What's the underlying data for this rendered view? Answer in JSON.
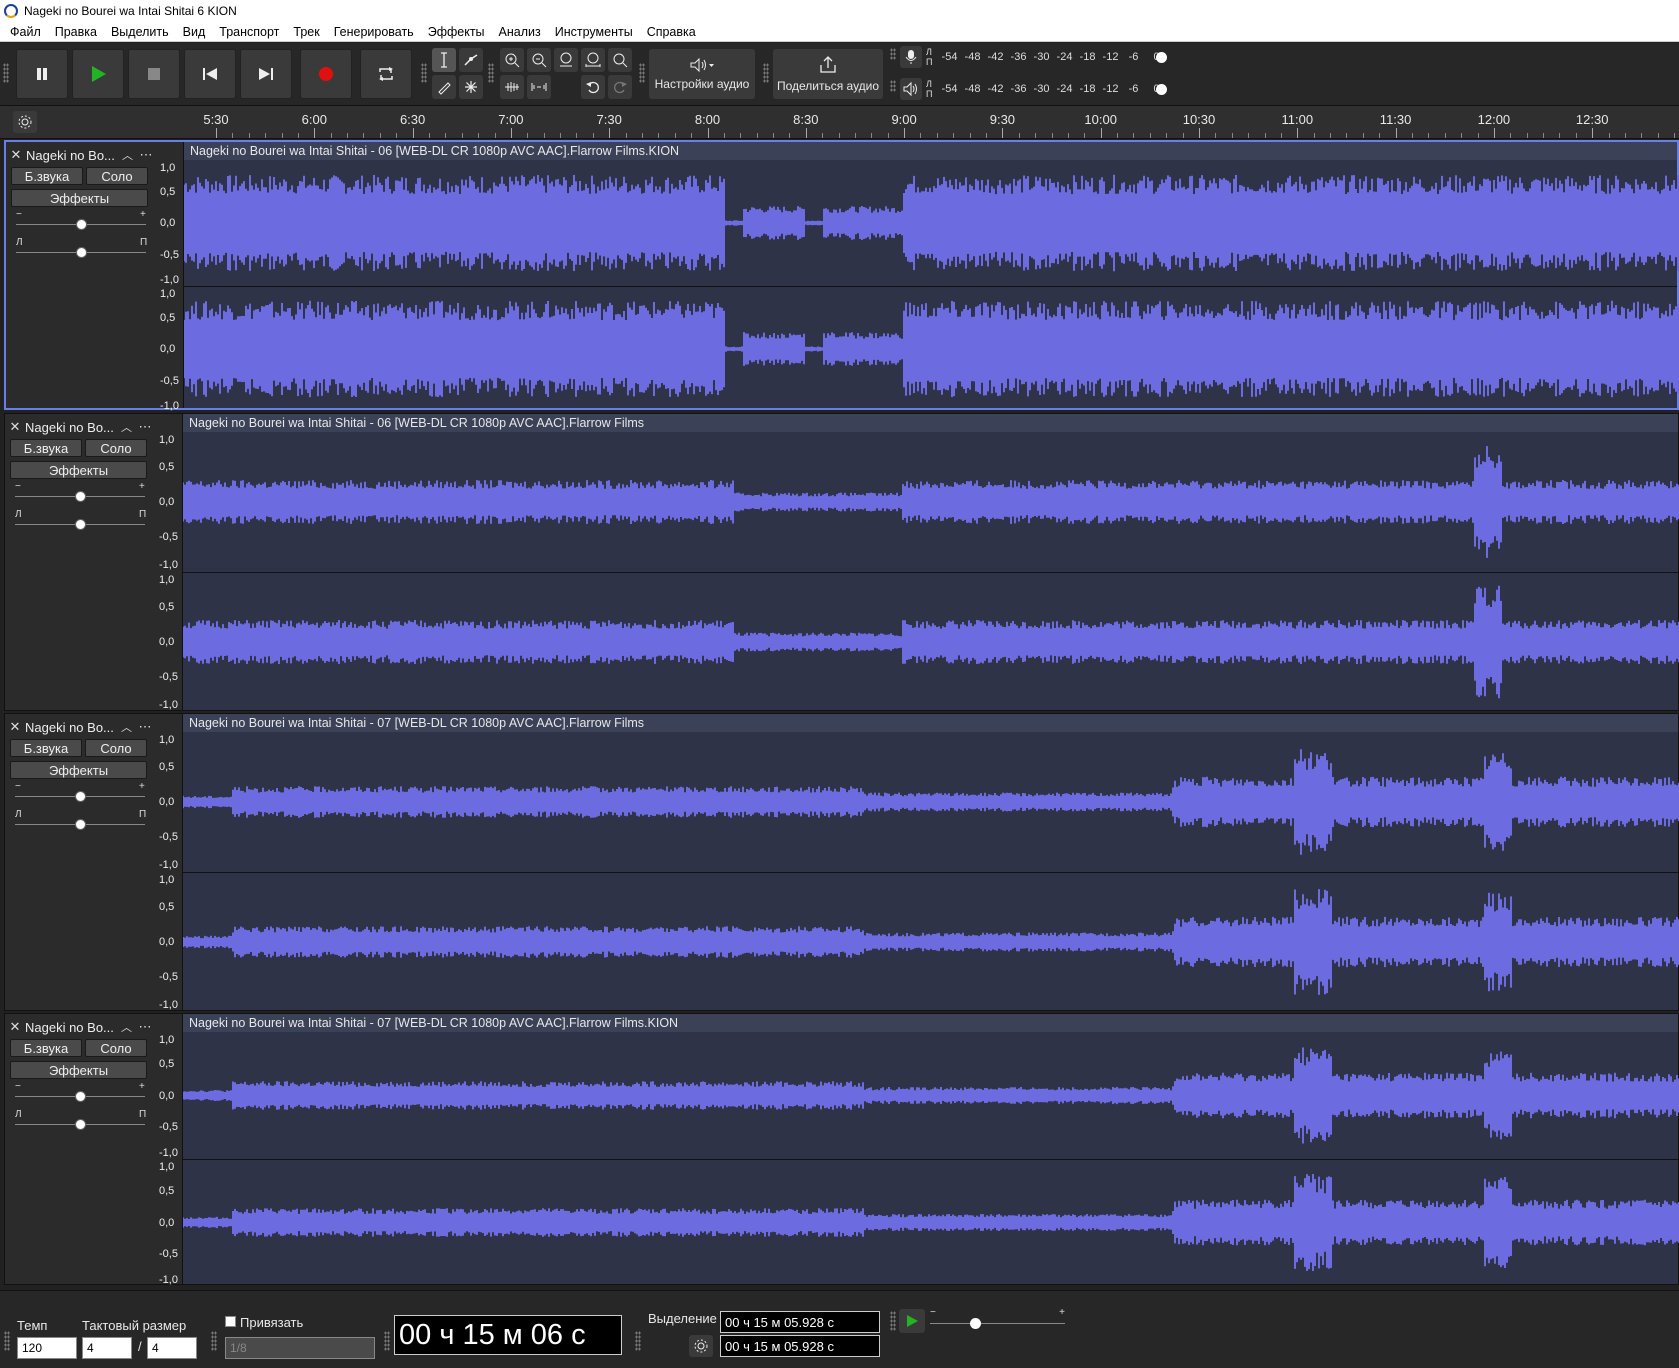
{
  "window": {
    "title": "Nageki no Bourei wa Intai Shitai  6 KION"
  },
  "menu": [
    "Файл",
    "Правка",
    "Выделить",
    "Вид",
    "Транспорт",
    "Трек",
    "Генерировать",
    "Эффекты",
    "Анализ",
    "Инструменты",
    "Справка"
  ],
  "toolbar": {
    "audio_setup_label": "Настройки аудио",
    "share_audio_label": "Поделиться аудио",
    "meter_scale": [
      "-54",
      "-48",
      "-42",
      "-36",
      "-30",
      "-24",
      "-18",
      "-12",
      "-6",
      "0"
    ],
    "meter_channel_labels": [
      "Л",
      "П"
    ]
  },
  "timeline": {
    "ticks": [
      "5:30",
      "6:00",
      "6:30",
      "7:00",
      "7:30",
      "8:00",
      "8:30",
      "9:00",
      "9:30",
      "10:00",
      "10:30",
      "11:00",
      "11:30",
      "12:00",
      "12:30"
    ]
  },
  "track_controls": {
    "mute_label": "Б.звука",
    "solo_label": "Соло",
    "effects_label": "Эффекты",
    "gain_min": "−",
    "gain_max": "+",
    "pan_left": "Л",
    "pan_right": "П",
    "scale_labels": [
      "1,0",
      "0,5",
      "0,0",
      "-0,5",
      "-1,0"
    ]
  },
  "tracks": [
    {
      "name": "Nageki no Bo...",
      "clip": "Nageki no Bourei wa Intai Shitai - 06 [WEB-DL CR 1080p AVC AAC].Flarrow Films.KION",
      "selected": true
    },
    {
      "name": "Nageki no Bo...",
      "clip": "Nageki no Bourei wa Intai Shitai - 06 [WEB-DL CR 1080p AVC AAC].Flarrow Films",
      "selected": false
    },
    {
      "name": "Nageki no Bo...",
      "clip": "Nageki no Bourei wa Intai Shitai - 07 [WEB-DL CR 1080p AVC AAC].Flarrow Films",
      "selected": false
    },
    {
      "name": "Nageki no Bo...",
      "clip": "Nageki no Bourei wa Intai Shitai - 07 [WEB-DL CR 1080p AVC AAC].Flarrow Films.KION",
      "selected": false
    }
  ],
  "bottom": {
    "tempo_label": "Темп",
    "tempo_value": "120",
    "time_sig_label": "Тактовый размер",
    "time_sig_num": "4",
    "time_sig_slash": "/",
    "time_sig_den": "4",
    "snap_label": "Привязать",
    "snap_value": "1/8",
    "position_time": "00 ч 15 м 06 с",
    "selection_label": "Выделение",
    "selection_start": "00 ч 15 м 05.928 с",
    "selection_end": "00 ч 15 м 05.928 с",
    "playback_speed_min": "−",
    "playback_speed_max": "+"
  },
  "colors": {
    "waveform": "#6d6be0",
    "clip_bg": "#2f3347",
    "clip_header": "#3b4156",
    "selected_border": "#6a7ee8",
    "record": "#e01010",
    "play": "#22b422"
  }
}
